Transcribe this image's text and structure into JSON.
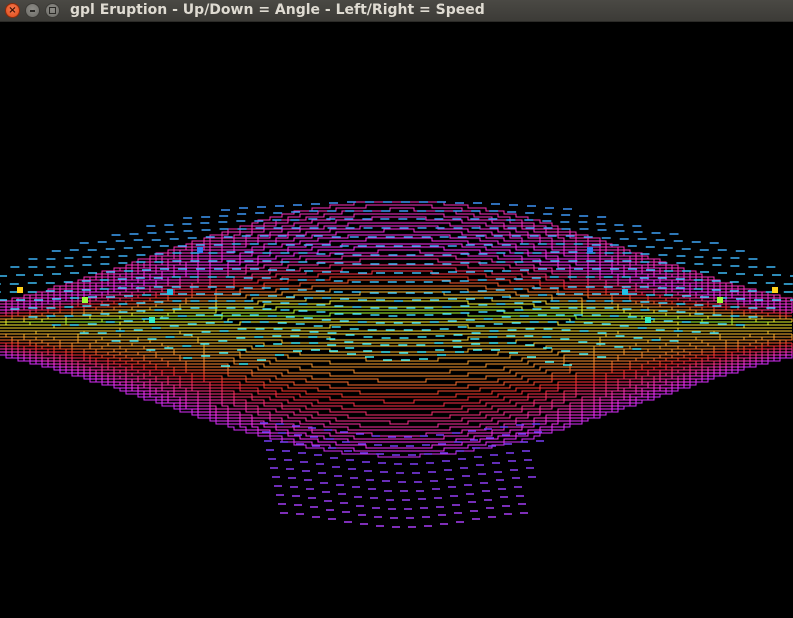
{
  "window": {
    "title": "gpl Eruption - Up/Down = Angle - Left/Right = Speed",
    "close_symbol": "×"
  },
  "icons": {
    "close": "close-icon",
    "minimize": "minimize-icon",
    "maximize": "maximize-icon"
  },
  "colors": {
    "titlebar": "#3c3b37",
    "close_button": "#df4a16",
    "canvas_background": "#000000"
  }
}
